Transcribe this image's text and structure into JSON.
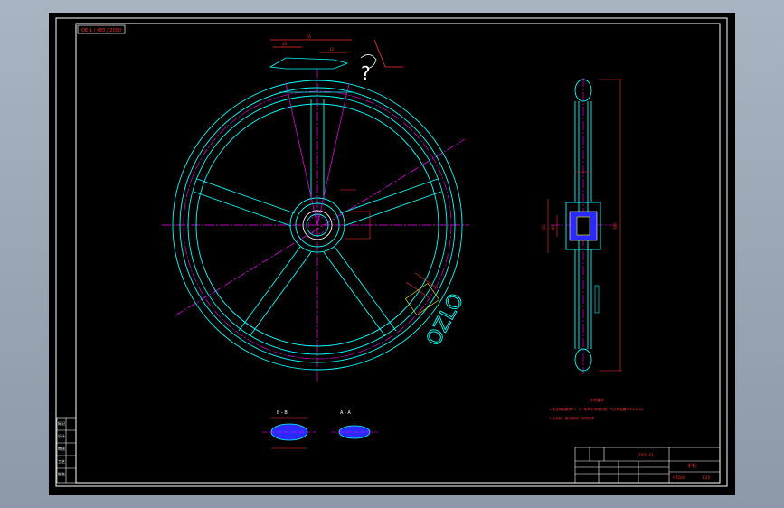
{
  "colors": {
    "frame": "#ffffff",
    "outline": "#00ffff",
    "center": "#ff00ff",
    "dim": "#ff3030",
    "hatch": "#4040ff",
    "text_red": "#ff3030",
    "text_white": "#ffffff",
    "yellow": "#ffff00"
  },
  "drawing": {
    "title_tag": "OE-1 / 4E0 / 2000",
    "section_b_label": "B - B",
    "section_a_label": "A - A",
    "hub_text": "OZLO",
    "note_title": "技术要求",
    "note_line_1": "1.未注铸造圆角R3~5，铸件不得有砂眼、气孔等缺陷",
    "note_line_2": "2.去毛刺、锐边倒钝，涂防锈漆",
    "note_right": "TYPE1/2000",
    "dim_top_1": "65",
    "dim_top_2": "20",
    "dim_top_3": "12",
    "dim_side_total": "780",
    "dim_side_hub": "100",
    "dim_side_bore": "40",
    "question_mark": "?"
  },
  "title_block": {
    "part_name": "手轮",
    "material": "HT200",
    "scale": "1:20",
    "code": "ZX02-01",
    "left_rows": [
      "标记",
      "设计",
      "审核",
      "工艺",
      "批准"
    ]
  }
}
